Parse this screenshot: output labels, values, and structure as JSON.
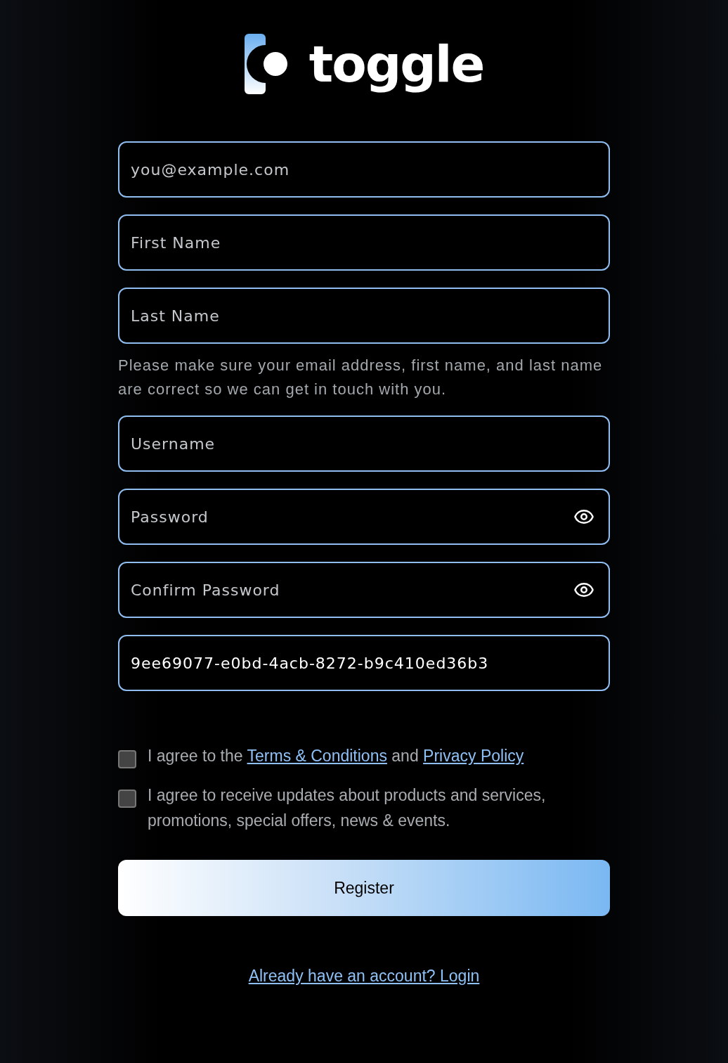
{
  "logo": {
    "wordmark": "toggle"
  },
  "fields": [
    {
      "kind": "text",
      "placeholder": "you@example.com"
    },
    {
      "kind": "text",
      "placeholder": "First Name"
    },
    {
      "kind": "text",
      "placeholder": "Last Name"
    },
    {
      "kind": "hint",
      "text": "Please make sure your email address, first name, and last name are correct so we can get in touch with you."
    },
    {
      "kind": "text",
      "placeholder": "Username"
    },
    {
      "kind": "password",
      "placeholder": "Password"
    },
    {
      "kind": "password",
      "placeholder": "Confirm Password"
    },
    {
      "kind": "text",
      "value": "9ee69077-e0bd-4acb-8272-b9c410ed36b3"
    }
  ],
  "agreements": [
    {
      "checked": false,
      "parts": [
        {
          "kind": "text",
          "text": "I agree to the "
        },
        {
          "kind": "link",
          "text": "Terms & Conditions"
        },
        {
          "kind": "text",
          "text": " and "
        },
        {
          "kind": "link",
          "text": "Privacy Policy"
        }
      ]
    },
    {
      "checked": false,
      "parts": [
        {
          "kind": "text",
          "text": "I agree to receive updates about products and services, promotions, special offers, news & events."
        }
      ]
    }
  ],
  "register_button": "Register",
  "login_link": "Already have an account? Login"
}
